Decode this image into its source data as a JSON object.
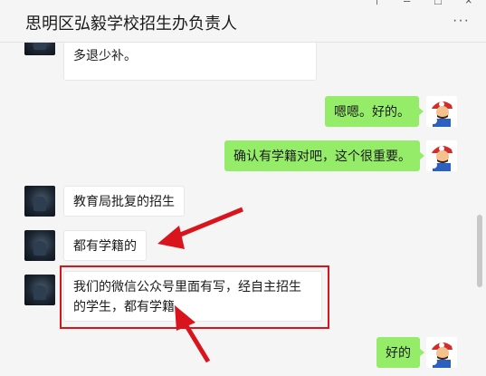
{
  "window": {
    "title": "思明区弘毅学校招生办负责人",
    "controls": {
      "pin": "⊤",
      "minimize": "–",
      "maximize": "□",
      "close": "×"
    },
    "more_label": "···"
  },
  "messages": [
    {
      "side": "left",
      "text": "多退少补。"
    },
    {
      "side": "right",
      "text": "嗯嗯。好的。"
    },
    {
      "side": "right",
      "text": "确认有学籍对吧，这个很重要。"
    },
    {
      "side": "left",
      "text": "教育局批复的招生"
    },
    {
      "side": "left",
      "text": "都有学籍的"
    },
    {
      "side": "left",
      "text": "我们的微信公众号里面有写，经自主招生的学生，都有学籍"
    },
    {
      "side": "right",
      "text": "好的"
    }
  ],
  "annotation_color": "#d9141c",
  "bubble_colors": {
    "self": "#95ec69",
    "other": "#ffffff"
  },
  "icons": {
    "other_avatar": "dark-photo-avatar",
    "self_avatar": "mario-avatar"
  }
}
